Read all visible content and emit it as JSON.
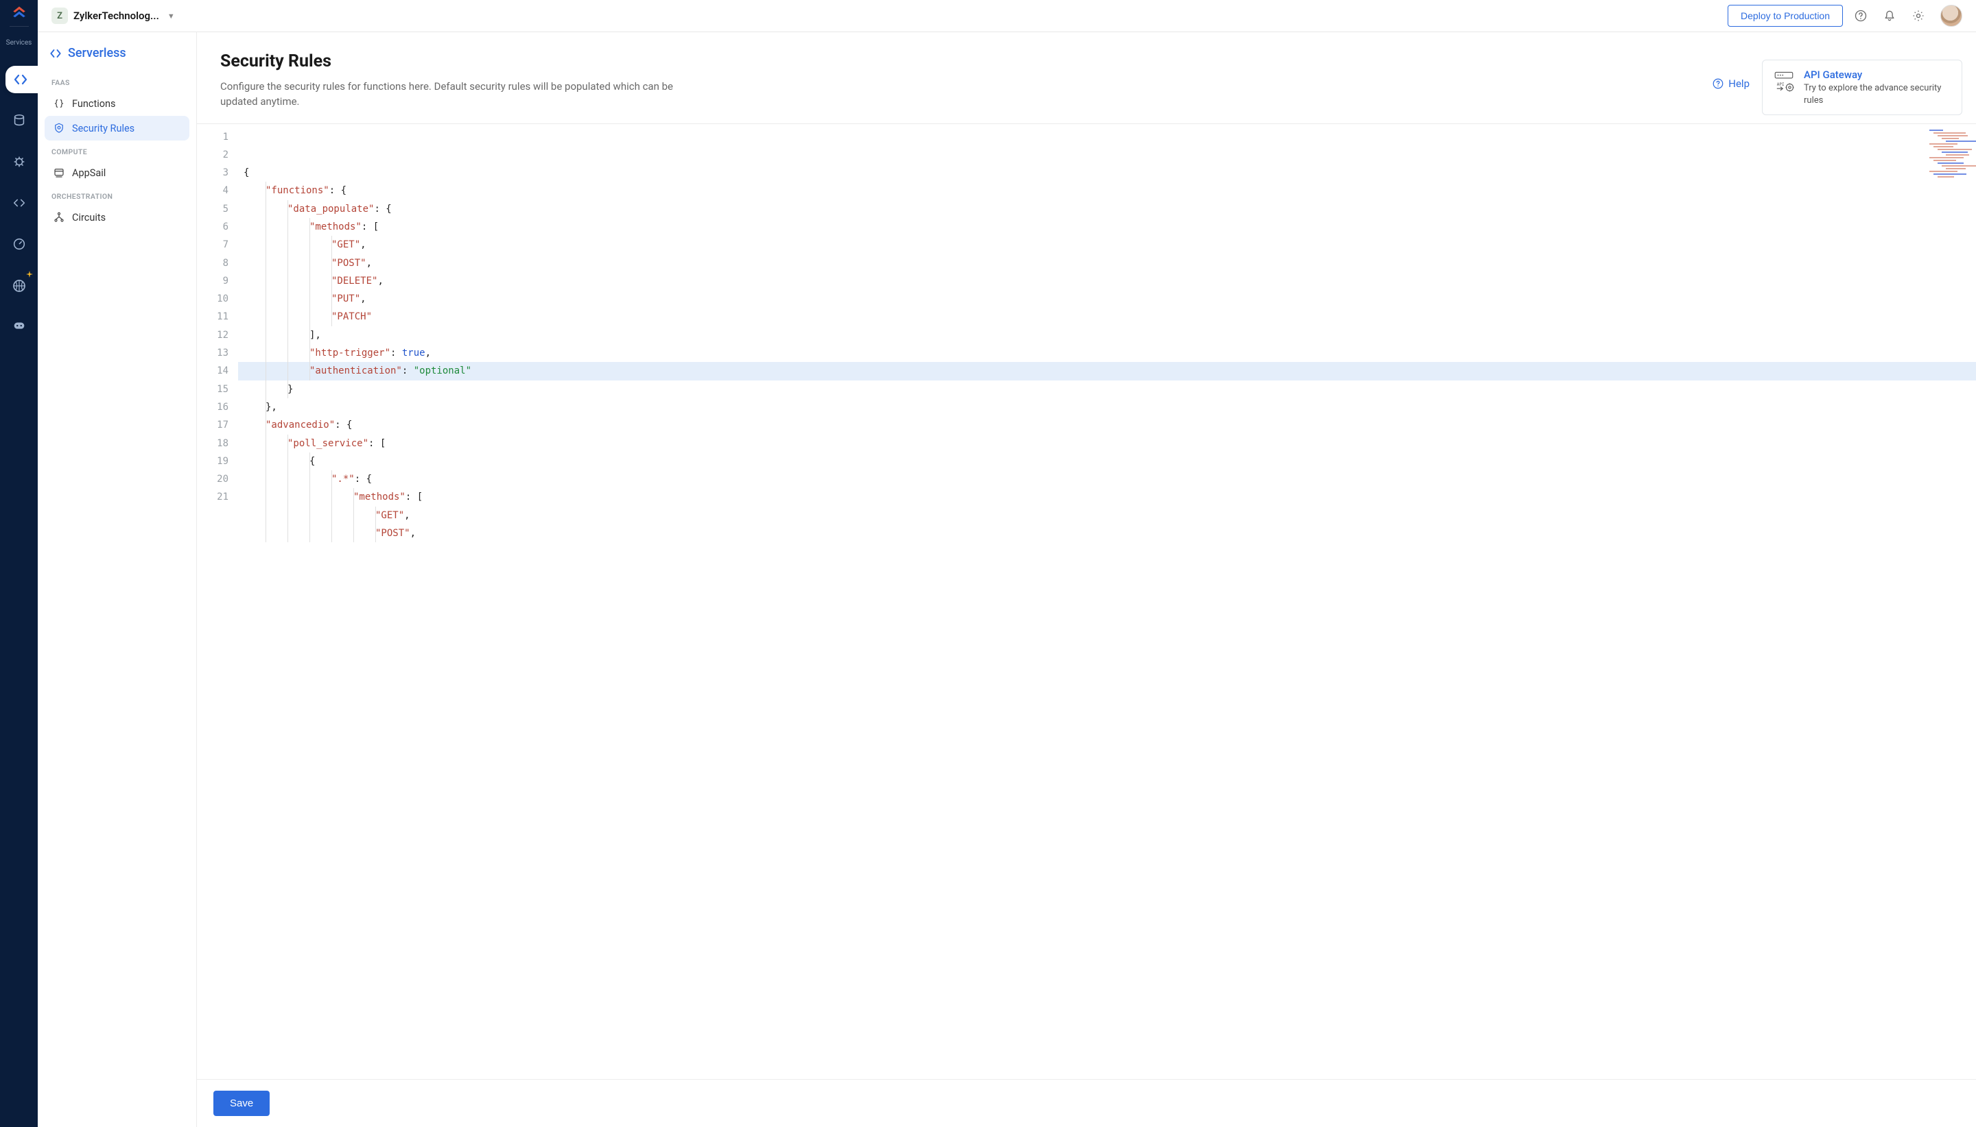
{
  "services_label": "Services",
  "project": {
    "initial": "Z",
    "name": "ZylkerTechnolog..."
  },
  "header": {
    "deploy_label": "Deploy to Production"
  },
  "sidebar": {
    "title": "Serverless",
    "groups": [
      {
        "label": "FAAS",
        "items": [
          {
            "icon": "braces",
            "label": "Functions"
          },
          {
            "icon": "shield",
            "label": "Security Rules",
            "active": true
          }
        ]
      },
      {
        "label": "COMPUTE",
        "items": [
          {
            "icon": "appsail",
            "label": "AppSail"
          }
        ]
      },
      {
        "label": "ORCHESTRATION",
        "items": [
          {
            "icon": "circuits",
            "label": "Circuits"
          }
        ]
      }
    ]
  },
  "page": {
    "title": "Security Rules",
    "desc": "Configure the security rules for functions here. Default security rules will be populated which can be updated anytime.",
    "help": "Help",
    "card_title": "API Gateway",
    "card_sub": "Try to explore the advance security rules",
    "save_label": "Save"
  },
  "editor": {
    "highlighted_line": 12,
    "lines": [
      [
        {
          "t": "{",
          "c": "p"
        }
      ],
      [
        {
          "t": "\"functions\"",
          "c": "k"
        },
        {
          "t": ": {",
          "c": "p"
        }
      ],
      [
        {
          "t": "\"data_populate\"",
          "c": "k"
        },
        {
          "t": ": {",
          "c": "p"
        }
      ],
      [
        {
          "t": "\"methods\"",
          "c": "k"
        },
        {
          "t": ": [",
          "c": "p"
        }
      ],
      [
        {
          "t": "\"GET\"",
          "c": "k"
        },
        {
          "t": ",",
          "c": "p"
        }
      ],
      [
        {
          "t": "\"POST\"",
          "c": "k"
        },
        {
          "t": ",",
          "c": "p"
        }
      ],
      [
        {
          "t": "\"DELETE\"",
          "c": "k"
        },
        {
          "t": ",",
          "c": "p"
        }
      ],
      [
        {
          "t": "\"PUT\"",
          "c": "k"
        },
        {
          "t": ",",
          "c": "p"
        }
      ],
      [
        {
          "t": "\"PATCH\"",
          "c": "k"
        }
      ],
      [
        {
          "t": "],",
          "c": "p"
        }
      ],
      [
        {
          "t": "\"http-trigger\"",
          "c": "k"
        },
        {
          "t": ": ",
          "c": "p"
        },
        {
          "t": "true",
          "c": "b"
        },
        {
          "t": ",",
          "c": "p"
        }
      ],
      [
        {
          "t": "\"authentication\"",
          "c": "k"
        },
        {
          "t": ": ",
          "c": "p"
        },
        {
          "t": "\"optional\"",
          "c": "s"
        }
      ],
      [
        {
          "t": "}",
          "c": "p"
        }
      ],
      [
        {
          "t": "},",
          "c": "p"
        }
      ],
      [
        {
          "t": "\"advancedio\"",
          "c": "k"
        },
        {
          "t": ": {",
          "c": "p"
        }
      ],
      [
        {
          "t": "\"poll_service\"",
          "c": "k"
        },
        {
          "t": ": [",
          "c": "p"
        }
      ],
      [
        {
          "t": "{",
          "c": "p"
        }
      ],
      [
        {
          "t": "\".*\"",
          "c": "k"
        },
        {
          "t": ": {",
          "c": "p"
        }
      ],
      [
        {
          "t": "\"methods\"",
          "c": "k"
        },
        {
          "t": ": [",
          "c": "p"
        }
      ],
      [
        {
          "t": "\"GET\"",
          "c": "k"
        },
        {
          "t": ",",
          "c": "p"
        }
      ],
      [
        {
          "t": "\"POST\"",
          "c": "k"
        },
        {
          "t": ",",
          "c": "p"
        }
      ]
    ],
    "indents": [
      0,
      1,
      2,
      3,
      4,
      4,
      4,
      4,
      4,
      3,
      3,
      3,
      2,
      1,
      1,
      2,
      3,
      4,
      5,
      6,
      6
    ]
  }
}
